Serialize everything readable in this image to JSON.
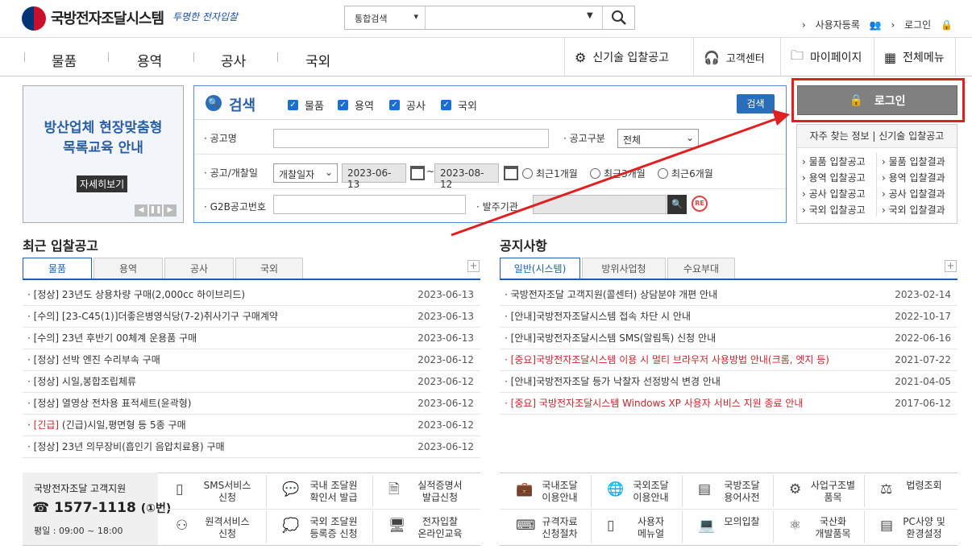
{
  "header": {
    "site_title": "국방전자조달시스템",
    "slogan": "투명한 전자입찰",
    "search_scope": "통합검색",
    "top_links": [
      "사용자등록",
      "로그인"
    ]
  },
  "nav": {
    "main": [
      "물품",
      "용역",
      "공사",
      "국외"
    ],
    "right": [
      "신기술 입찰공고",
      "고객센터",
      "마이페이지",
      "전체메뉴"
    ]
  },
  "banner": {
    "line1": "방산업체 현장맞춤형",
    "line2": "목록교육 안내",
    "more": "자세히보기"
  },
  "search": {
    "title": "검색",
    "checks": [
      "물품",
      "용역",
      "공사",
      "국외"
    ],
    "button": "검색",
    "l_name": "공고명",
    "l_type": "공고구분",
    "type_value": "전체",
    "l_date": "공고/개찰일",
    "date_kind": "개찰일자",
    "date_from": "2023-06-13",
    "date_to": "2023-08-12",
    "tilde": "~",
    "r1": "최근1개월",
    "r3": "최근3개월",
    "r6": "최근6개월",
    "l_g2b": "G2B공고번호",
    "l_org": "발주기관"
  },
  "login": {
    "label": "로그인"
  },
  "fav": {
    "head": "자주 찾는 정보 | 신기술 입찰공고",
    "left": [
      "물품 입찰공고",
      "용역 입찰공고",
      "공사 입찰공고",
      "국외 입찰공고"
    ],
    "right": [
      "물품 입찰결과",
      "용역 입찰결과",
      "공사 입찰결과",
      "국외 입찰결과"
    ]
  },
  "bids": {
    "title": "최근 입찰공고",
    "tabs": [
      "물품",
      "용역",
      "공사",
      "국외"
    ],
    "rows": [
      {
        "tag": "[정상]",
        "text": " 23년도 상용차량 구매(2,000cc 하이브리드)",
        "date": "2023-06-13"
      },
      {
        "tag": "[수의]",
        "text": " [23-C45(1)]더좋은병영식당(7-2)취사기구 구매계약",
        "date": "2023-06-13"
      },
      {
        "tag": "[수의]",
        "text": " 23년 후반기 00체계 운용품 구매",
        "date": "2023-06-13"
      },
      {
        "tag": "[정상]",
        "text": " 선박 엔진 수리부속 구매",
        "date": "2023-06-12"
      },
      {
        "tag": "[정상]",
        "text": " 시일,봉합조립체류",
        "date": "2023-06-12"
      },
      {
        "tag": "[정상]",
        "text": " 열영상 전차용 표적세트(윤곽형)",
        "date": "2023-06-12"
      },
      {
        "tag": "[긴급]",
        "text": " (긴급)시일,평면형 등 5종 구매",
        "date": "2023-06-12"
      },
      {
        "tag": "[정상]",
        "text": " 23년 의무장비(흡인기 음압치료용) 구매",
        "date": "2023-06-12"
      }
    ]
  },
  "notices": {
    "title": "공지사항",
    "tabs": [
      "일반(시스템)",
      "방위사업청",
      "수요부대"
    ],
    "rows": [
      {
        "text": "국방전자조달 고객지원(콜센터) 상담분야 개편 안내",
        "date": "2023-02-14",
        "red": false
      },
      {
        "text": "[안내]국방전자조달시스템 접속 차단 시 안내",
        "date": "2022-10-17",
        "red": false
      },
      {
        "text": "[안내]국방전자조달시스템 SMS(알림톡) 신청 안내",
        "date": "2022-06-16",
        "red": false
      },
      {
        "text": "[중요]국방전자조달시스템 이용 시 멀티 브라우저 사용방법 안내(크롬, 엣지 등)",
        "date": "2021-07-22",
        "red": true
      },
      {
        "text": "[안내]국방전자조달 등가 낙찰자 선정방식 변경 안내",
        "date": "2021-04-05",
        "red": false
      },
      {
        "text": "[중요] 국방전자조달시스템 Windows XP 사용자 서비스 지원 종료 안내",
        "date": "2017-06-12",
        "red": true
      }
    ]
  },
  "support": {
    "title": "국방전자조달 고객지원",
    "phone": "1577-1118",
    "phone_ext": "(①번)",
    "hours": "평일 : 09:00 ~ 18:00"
  },
  "quick_left": [
    [
      "SMS서비스",
      "신청"
    ],
    [
      "국내 조달원",
      "확인서 발급"
    ],
    [
      "실적증명서",
      "발급신청"
    ],
    [
      "원격서비스",
      "신청"
    ],
    [
      "국외 조달원",
      "등록증 신청"
    ],
    [
      "전자입찰",
      "온라인교육"
    ]
  ],
  "quick_right": [
    [
      "국내조달",
      "이용안내"
    ],
    [
      "국외조달",
      "이용안내"
    ],
    [
      "국방조달",
      "용어사전"
    ],
    [
      "사업구조별",
      "품목"
    ],
    [
      "법령조회",
      ""
    ],
    [
      "규격자료",
      "신청절차"
    ],
    [
      "사용자",
      "메뉴얼"
    ],
    [
      "모의입찰",
      ""
    ],
    [
      "국산화",
      "개발품목"
    ],
    [
      "PC사양 및",
      "환경설정"
    ]
  ]
}
